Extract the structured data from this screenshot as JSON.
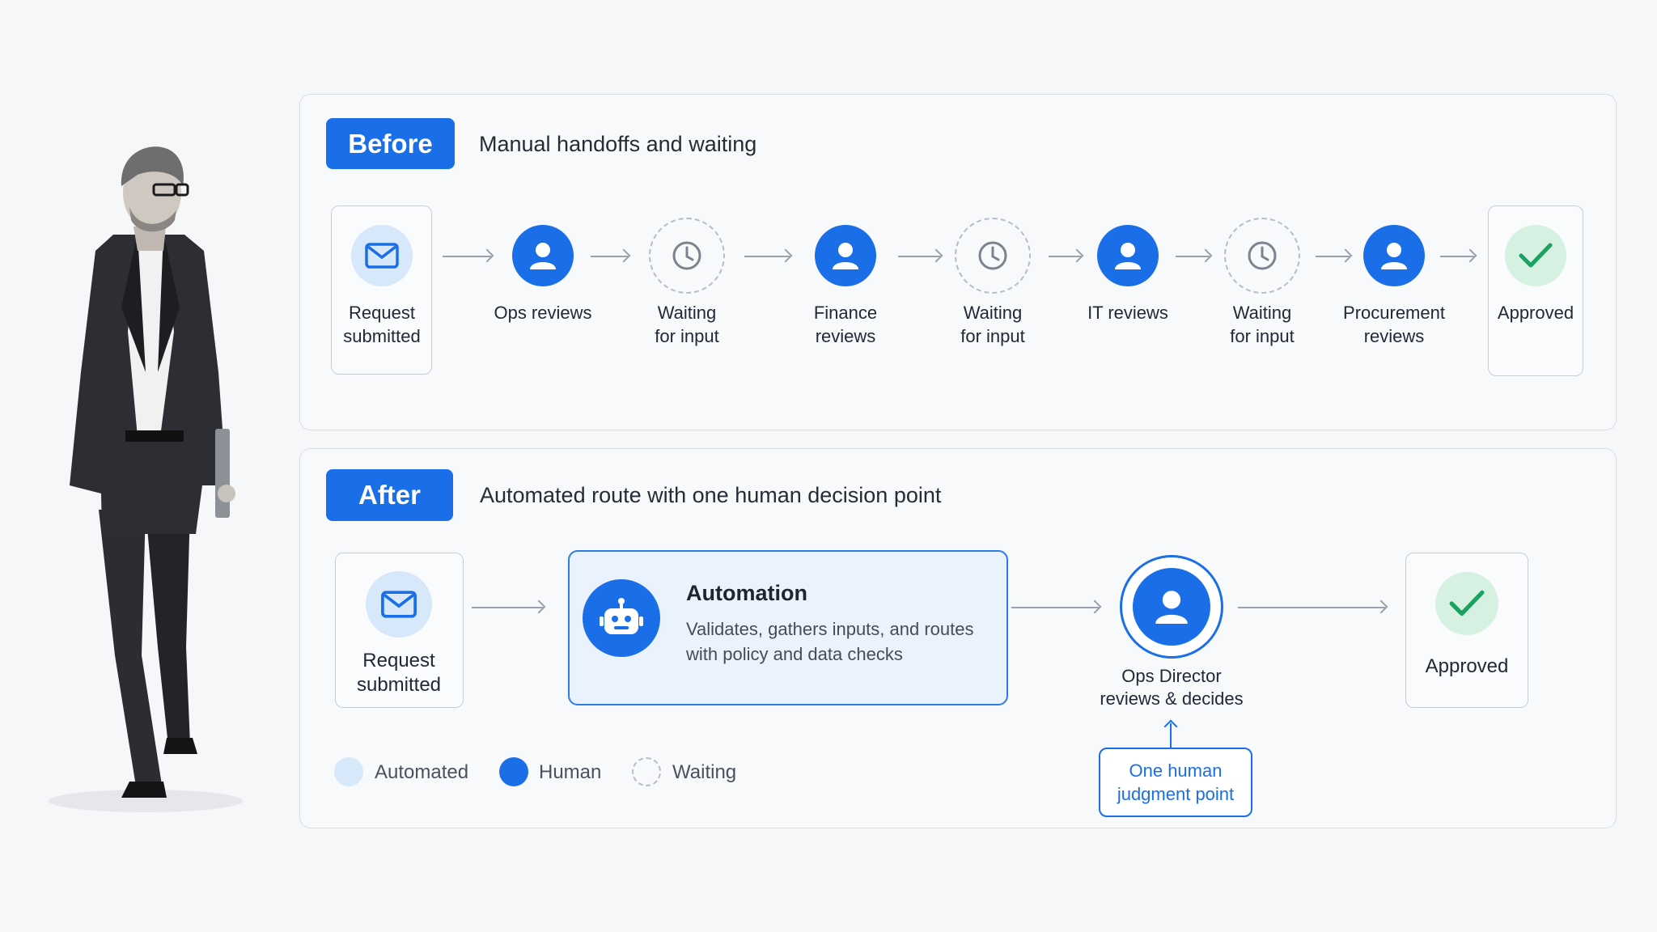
{
  "before": {
    "tag": "Before",
    "subtitle": "Manual handoffs and waiting",
    "steps": [
      {
        "label": "Request\nsubmitted",
        "kind": "automated",
        "icon": "envelope-icon"
      },
      {
        "label": "Ops reviews",
        "kind": "human",
        "icon": "person-icon"
      },
      {
        "label": "Waiting\nfor input",
        "kind": "waiting",
        "icon": "clock-icon"
      },
      {
        "label": "Finance\nreviews",
        "kind": "human",
        "icon": "person-icon"
      },
      {
        "label": "Waiting\nfor input",
        "kind": "waiting",
        "icon": "clock-icon"
      },
      {
        "label": "IT reviews",
        "kind": "human",
        "icon": "person-icon"
      },
      {
        "label": "Waiting\nfor input",
        "kind": "waiting",
        "icon": "clock-icon"
      },
      {
        "label": "Procurement\nreviews",
        "kind": "human",
        "icon": "person-icon"
      },
      {
        "label": "Approved",
        "kind": "done",
        "icon": "checkmark-icon"
      }
    ]
  },
  "after": {
    "tag": "After",
    "subtitle": "Automated route with one human decision point",
    "request_label": "Request\nsubmitted",
    "automation_title": "Automation",
    "automation_desc": "Validates, gathers inputs, and routes with policy and data checks",
    "director_label": "Ops Director\nreviews & decides",
    "callout": "One human\njudgment point",
    "approved_label": "Approved"
  },
  "legend": {
    "automated": "Automated",
    "human": "Human",
    "waiting": "Waiting"
  },
  "colors": {
    "accent": "#1a6fe8",
    "automated": "#d8e8fb",
    "approved": "#d6f1e2",
    "check": "#1aa260"
  }
}
